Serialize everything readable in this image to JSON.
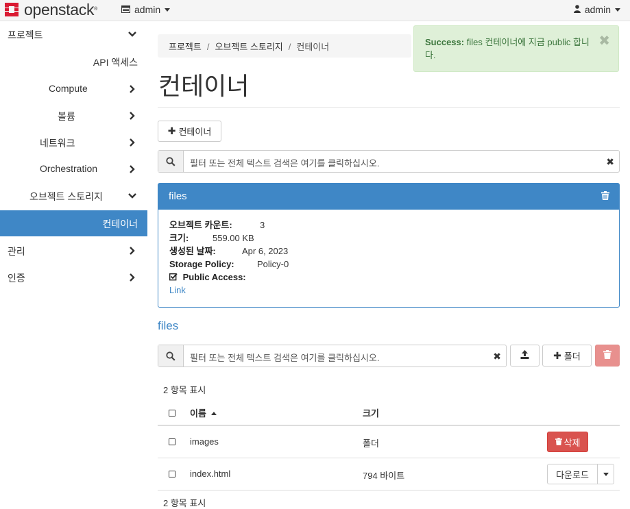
{
  "navbar": {
    "brand": "openstack",
    "brand_mark": "®",
    "project_label": "admin",
    "user_label": "admin"
  },
  "sidebar": {
    "items": [
      {
        "label": "프로젝트"
      },
      {
        "label": "API 액세스"
      },
      {
        "label": "Compute"
      },
      {
        "label": "볼륨"
      },
      {
        "label": "네트워크"
      },
      {
        "label": "Orchestration"
      },
      {
        "label": "오브젝트 스토리지"
      },
      {
        "label": "컨테이너"
      },
      {
        "label": "관리"
      },
      {
        "label": "인증"
      }
    ]
  },
  "breadcrumb": {
    "items": [
      "프로젝트",
      "오브젝트 스토리지",
      "컨테이너"
    ],
    "sep": "/"
  },
  "page": {
    "title": "컨테이너",
    "add_container_label": "컨테이너",
    "filter_placeholder": "필터 또는 전체 텍스트 검색은 여기를 클릭하십시오."
  },
  "alert": {
    "strong": "Success:",
    "message": "files 컨테이너에 지금 public 합니다."
  },
  "container_panel": {
    "name": "files",
    "object_count_label": "오브젝트 카운트:",
    "object_count": "3",
    "size_label": "크기:",
    "size": "559.00 KB",
    "created_label": "생성된 날짜:",
    "created": "Apr 6, 2023",
    "policy_label": "Storage Policy:",
    "policy": "Policy-0",
    "public_label": "Public Access:",
    "link_label": "Link"
  },
  "objects": {
    "title": "files",
    "filter_placeholder": "필터 또는 전체 텍스트 검색은 여기를 클릭하십시오.",
    "folder_button": "폴더",
    "count_text": "2 항목 표시",
    "col_name": "이름",
    "col_size": "크기",
    "rows": [
      {
        "name": "images",
        "size": "폴더",
        "action": "삭제"
      },
      {
        "name": "index.html",
        "size": "794 바이트",
        "action": "다운로드"
      }
    ]
  },
  "colors": {
    "primary": "#3f87c6",
    "danger": "#d9534f",
    "success_bg": "#dff0d8",
    "success_text": "#3c763d"
  }
}
